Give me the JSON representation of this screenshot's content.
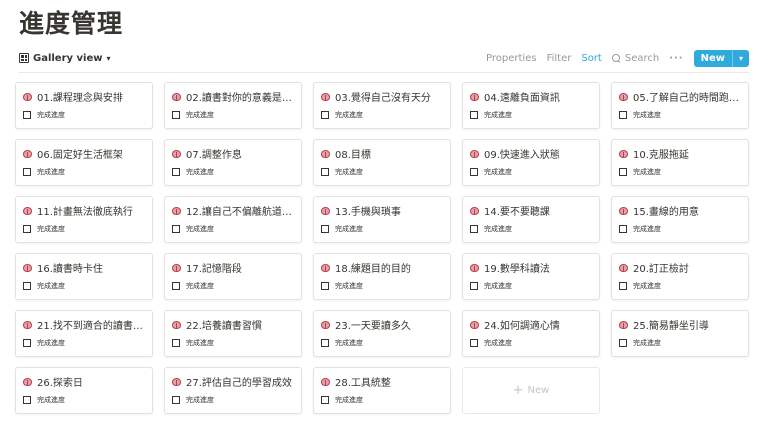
{
  "page": {
    "title": "進度管理"
  },
  "toolbar": {
    "view_label": "Gallery view",
    "properties_label": "Properties",
    "filter_label": "Filter",
    "sort_label": "Sort",
    "search_label": "Search",
    "more_label": "···",
    "new_label": "New",
    "new_caret": "▾",
    "view_caret": "▾"
  },
  "cards": [
    {
      "title": "01.課程理念與安排",
      "property": "完成進度",
      "checked": false
    },
    {
      "title": "02.讀書對你的意義是什麼?",
      "property": "完成進度",
      "checked": false
    },
    {
      "title": "03.覺得自己沒有天分",
      "property": "完成進度",
      "checked": false
    },
    {
      "title": "04.遠離負面資訊",
      "property": "完成進度",
      "checked": false
    },
    {
      "title": "05.了解自己的時間跑去哪?",
      "property": "完成進度",
      "checked": false
    },
    {
      "title": "06.固定好生活框架",
      "property": "完成進度",
      "checked": false
    },
    {
      "title": "07.調整作息",
      "property": "完成進度",
      "checked": false
    },
    {
      "title": "08.目標",
      "property": "完成進度",
      "checked": false
    },
    {
      "title": "09.快速進入狀態",
      "property": "完成進度",
      "checked": false
    },
    {
      "title": "10.克服拖延",
      "property": "完成進度",
      "checked": false
    },
    {
      "title": "11.計畫無法徹底執行",
      "property": "完成進度",
      "checked": false
    },
    {
      "title": "12.讓自己不偏離航道的...",
      "property": "完成進度",
      "checked": false
    },
    {
      "title": "13.手機與瑣事",
      "property": "完成進度",
      "checked": false
    },
    {
      "title": "14.要不要聽課",
      "property": "完成進度",
      "checked": false
    },
    {
      "title": "15.畫線的用意",
      "property": "完成進度",
      "checked": false
    },
    {
      "title": "16.讀書時卡住",
      "property": "完成進度",
      "checked": false
    },
    {
      "title": "17.記憶階段",
      "property": "完成進度",
      "checked": false
    },
    {
      "title": "18.練題目的目的",
      "property": "完成進度",
      "checked": false
    },
    {
      "title": "19.數學科讀法",
      "property": "完成進度",
      "checked": false
    },
    {
      "title": "20.訂正檢討",
      "property": "完成進度",
      "checked": false
    },
    {
      "title": "21.找不到適合的讀書方法",
      "property": "完成進度",
      "checked": false
    },
    {
      "title": "22.培養讀書習慣",
      "property": "完成進度",
      "checked": false
    },
    {
      "title": "23.一天要讀多久",
      "property": "完成進度",
      "checked": false
    },
    {
      "title": "24.如何調適心情",
      "property": "完成進度",
      "checked": false
    },
    {
      "title": "25.簡易靜坐引導",
      "property": "完成進度",
      "checked": false
    },
    {
      "title": "26.探索日",
      "property": "完成進度",
      "checked": false
    },
    {
      "title": "27.評估自己的學習成效",
      "property": "完成進度",
      "checked": false
    },
    {
      "title": "28.工具統整",
      "property": "完成進度",
      "checked": false
    }
  ],
  "new_card": {
    "plus": "+",
    "label": "New"
  },
  "icons": {
    "card_icon": "brain-icon",
    "view_icon": "gallery-grid-icon",
    "search_icon": "search-icon",
    "more_icon": "more-icon"
  },
  "colors": {
    "accent": "#2eaadc",
    "text": "#37352f",
    "muted": "#9b9a97",
    "border": "#e3e2e0"
  }
}
